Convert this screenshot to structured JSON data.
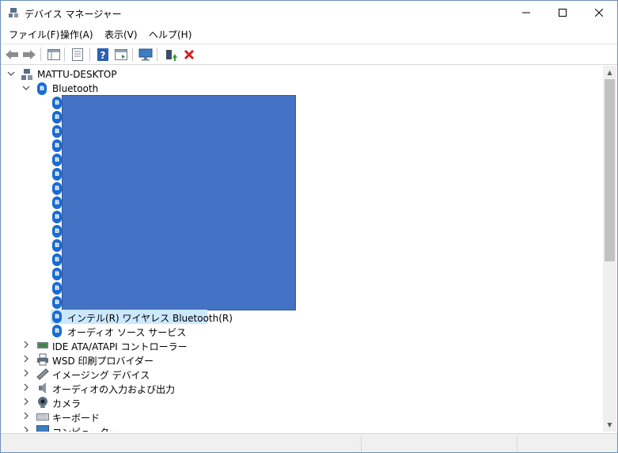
{
  "window": {
    "title": "デバイス マネージャー"
  },
  "menu": [
    {
      "label": "ファイル(F)"
    },
    {
      "label": "操作(A)"
    },
    {
      "label": "表示(V)"
    },
    {
      "label": "ヘルプ(H)"
    }
  ],
  "tree": {
    "root": "MATTU-DESKTOP",
    "bluetooth": "Bluetooth",
    "bt_children_redacted_count": 15,
    "intel": "インテル(R) ワイヤレス Bluetooth(R)",
    "audio_service": "オーディオ ソース サービス",
    "categories": [
      {
        "label": "IDE ATA/ATAPI コントローラー",
        "icon": "ide-controller-icon"
      },
      {
        "label": "WSD 印刷プロバイダー",
        "icon": "printer-icon"
      },
      {
        "label": "イメージング デバイス",
        "icon": "imaging-device-icon"
      },
      {
        "label": "オーディオの入力および出力",
        "icon": "speaker-icon"
      },
      {
        "label": "カメラ",
        "icon": "camera-icon"
      },
      {
        "label": "キーボード",
        "icon": "keyboard-icon"
      },
      {
        "label": "コンピューター",
        "icon": "computer-icon"
      }
    ]
  },
  "colors": {
    "selection": "#cce8ff",
    "bluetooth": "#1a6bd4",
    "redaction": "#4472c4"
  }
}
